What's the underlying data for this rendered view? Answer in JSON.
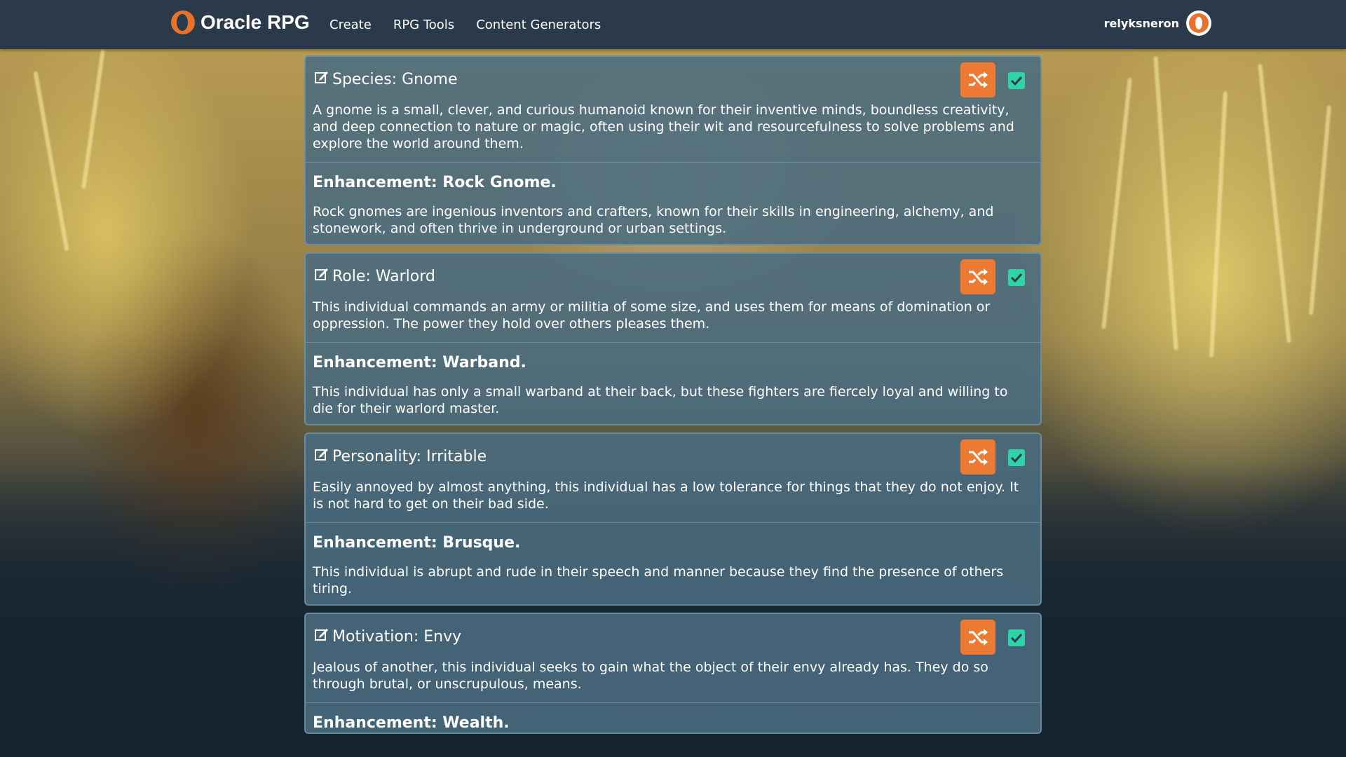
{
  "nav": {
    "brand": "Oracle RPG",
    "links": [
      "Create",
      "RPG Tools",
      "Content Generators"
    ],
    "username": "relyksneron"
  },
  "colors": {
    "accent": "#ec7a32",
    "check": "#2ed3a6",
    "nav_bg": "#2b3a4a",
    "card_bg": "#4a6c80"
  },
  "icons": {
    "edit": "edit-icon",
    "shuffle": "shuffle-icon",
    "check": "check-icon"
  },
  "cards": [
    {
      "title": "Species: Gnome",
      "description": "A gnome is a small, clever, and curious humanoid known for their inventive minds, boundless creativity, and deep connection to nature or magic, often using their wit and resourcefulness to solve problems and explore the world around them.",
      "enhancement_title": "Enhancement: Rock Gnome.",
      "enhancement_description": "Rock gnomes are ingenious inventors and crafters, known for their skills in engineering, alchemy, and stonework, and often thrive in underground or urban settings."
    },
    {
      "title": "Role: Warlord",
      "description": "This individual commands an army or militia of some size, and uses them for means of domination or oppression. The power they hold over others pleases them.",
      "enhancement_title": "Enhancement: Warband.",
      "enhancement_description": "This individual has only a small warband at their back, but these fighters are fiercely loyal and willing to die for their warlord master."
    },
    {
      "title": "Personality: Irritable",
      "description": "Easily annoyed by almost anything, this individual has a low tolerance for things that they do not enjoy. It is not hard to get on their bad side.",
      "enhancement_title": "Enhancement: Brusque.",
      "enhancement_description": "This individual is abrupt and rude in their speech and manner because they find the presence of others tiring."
    },
    {
      "title": "Motivation: Envy",
      "description": "Jealous of another, this individual seeks to gain what the object of their envy already has. They do so through brutal, or unscrupulous, means.",
      "enhancement_title": "Enhancement: Wealth.",
      "enhancement_description": ""
    }
  ]
}
